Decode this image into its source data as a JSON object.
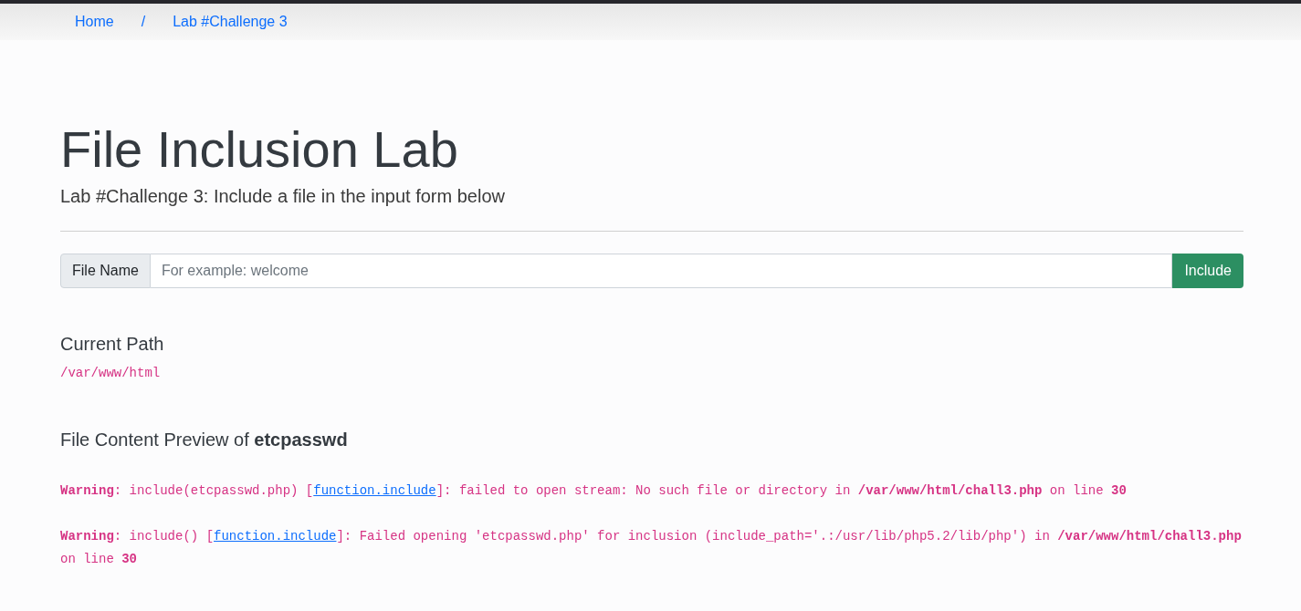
{
  "breadcrumb": [
    {
      "kind": "link",
      "label": "Home"
    },
    {
      "kind": "separator",
      "label": "/"
    },
    {
      "kind": "link",
      "label": "Lab #Challenge 3"
    }
  ],
  "header": {
    "title": "File Inclusion Lab",
    "subtitle": "Lab #Challenge 3: Include a file in the input form below"
  },
  "form": {
    "label": "File Name",
    "placeholder": "For example: welcome",
    "button": "Include"
  },
  "current_path": {
    "heading": "Current Path",
    "path": "/var/www/html"
  },
  "preview": {
    "heading": "File Content Preview of **etcpasswd**",
    "warnings": [
      {
        "before": "**Warning**: include(etcpasswd.php) [",
        "link": "function.include",
        "after": "]: failed to open stream: No such file or directory in **/var/www/html/chall3.php** on line **30**"
      },
      {
        "before": "**Warning**: include() [",
        "link": "function.include",
        "after": "]: Failed opening 'etcpasswd.php' for inclusion (include_path='.:/usr/lib/php5.2/lib/php') in **/var/www/html/chall3.php** on line **30**"
      }
    ]
  }
}
